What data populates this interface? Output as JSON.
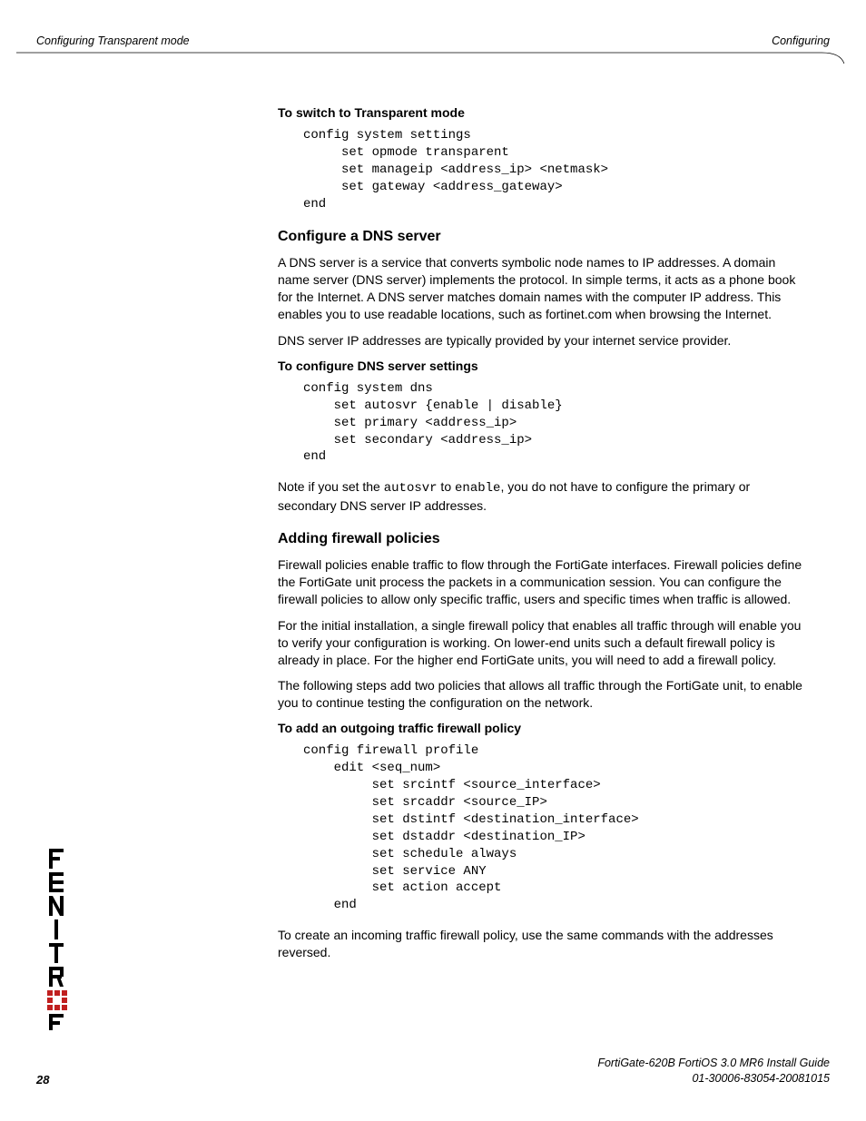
{
  "header": {
    "left": "Configuring Transparent mode",
    "right": "Configuring"
  },
  "sections": {
    "switch": {
      "title": "To switch to Transparent mode",
      "code": "config system settings\n     set opmode transparent\n     set manageip <address_ip> <netmask>\n     set gateway <address_gateway>\nend"
    },
    "dns": {
      "heading": "Configure a DNS server",
      "para1": "A DNS server is a service that converts symbolic node names to IP addresses. A domain name server (DNS server) implements the protocol. In simple terms, it acts as a phone book for the Internet. A DNS server matches domain names with the computer IP address. This enables you to use readable locations, such as fortinet.com when browsing the Internet.",
      "para2": "DNS server IP addresses are typically provided by your internet service provider.",
      "proc_title": "To configure DNS server settings",
      "code": "config system dns\n    set autosvr {enable | disable}\n    set primary <address_ip>\n    set secondary <address_ip>\nend",
      "note_pre": "Note if you set the ",
      "note_mono1": "autosvr",
      "note_mid": " to ",
      "note_mono2": "enable",
      "note_post": ", you do not have to configure the primary or secondary DNS server IP addresses."
    },
    "firewall": {
      "heading": "Adding firewall policies",
      "para1": "Firewall policies enable traffic to flow through the FortiGate interfaces. Firewall policies define the FortiGate unit process the packets in a communication session. You can configure the firewall policies to allow only specific traffic, users and specific times when traffic is allowed.",
      "para2": "For the initial installation, a single firewall policy that enables all traffic through will enable you to verify your configuration is working. On lower-end units such a default firewall policy is already in place. For the higher end FortiGate units, you will need to add a firewall policy.",
      "para3": "The following steps add two policies that allows all traffic through the FortiGate unit, to enable you to continue testing the configuration on the network.",
      "proc_title": "To add an outgoing traffic firewall policy",
      "code": "config firewall profile\n    edit <seq_num>\n         set srcintf <source_interface>\n         set srcaddr <source_IP>\n         set dstintf <destination_interface>\n         set dstaddr <destination_IP>\n         set schedule always\n         set service ANY\n         set action accept\n    end",
      "para4": "To create an incoming traffic firewall policy, use the same commands with the addresses reversed."
    }
  },
  "footer": {
    "line1": "FortiGate-620B FortiOS 3.0 MR6 Install Guide",
    "line2": "01-30006-83054-20081015",
    "page": "28"
  }
}
